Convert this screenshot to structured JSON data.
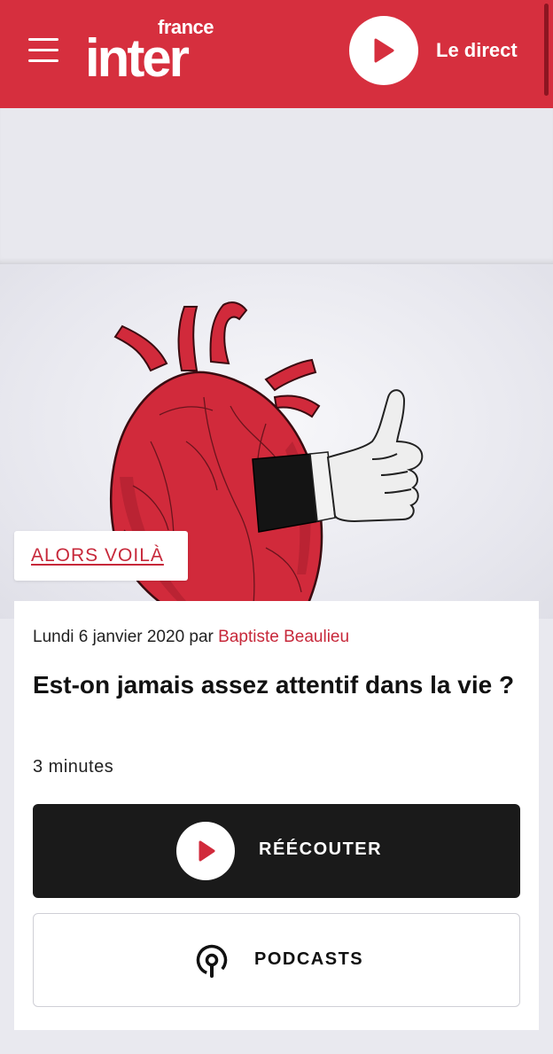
{
  "header": {
    "menu_icon": "hamburger-menu-icon",
    "logo_top": "france",
    "logo_main": "inter",
    "live_icon": "play-icon",
    "live_label": "Le direct",
    "brand_color": "#d62f3e"
  },
  "hero": {
    "illustration": "anatomical-heart-with-thumbs-up-hand",
    "category_label": "ALORS VOILÀ"
  },
  "article": {
    "date": "Lundi 6 janvier 2020",
    "by_label": "par",
    "author": "Baptiste Beaulieu",
    "title": "Est-on jamais assez attentif dans la vie ?",
    "duration": "3 minutes",
    "replay_label": "RÉÉCOUTER",
    "replay_icon": "play-icon",
    "podcasts_label": "PODCASTS",
    "podcasts_icon": "podcast-icon",
    "accent_color": "#c7283a"
  }
}
